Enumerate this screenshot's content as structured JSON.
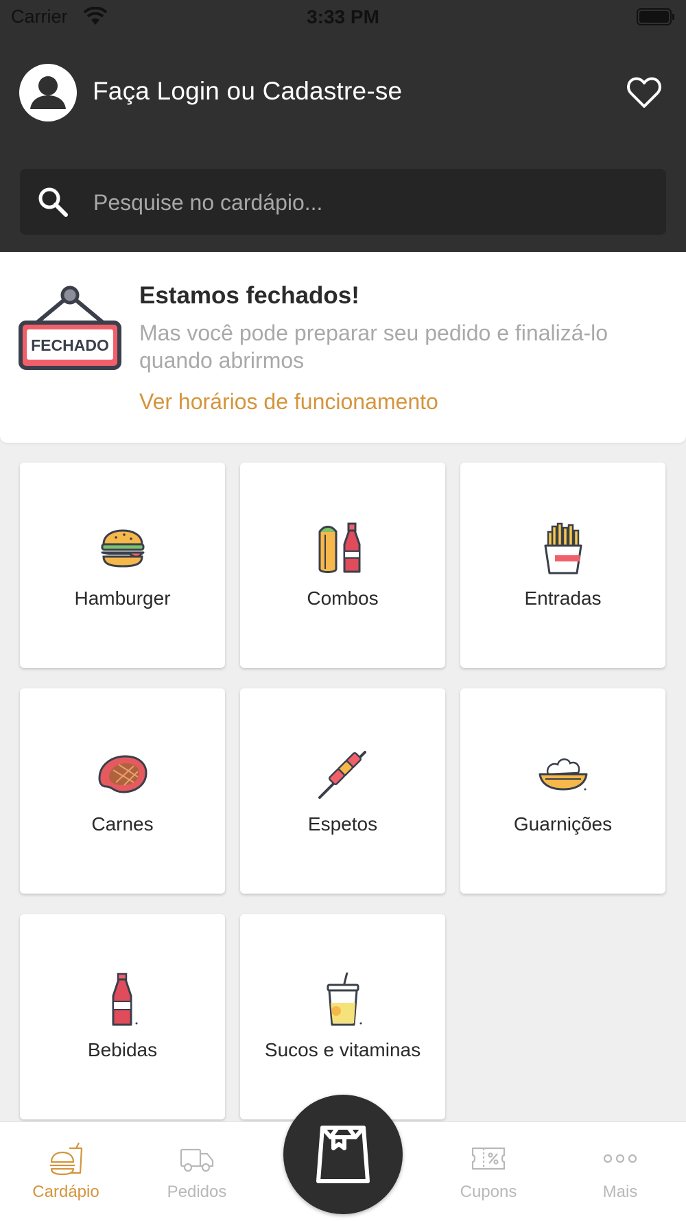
{
  "status_bar": {
    "carrier": "Carrier",
    "time": "3:33 PM"
  },
  "header": {
    "login_text": "Faça Login ou Cadastre-se",
    "avatar_icon": "user-avatar-icon",
    "favorite_icon": "heart-icon"
  },
  "search": {
    "placeholder": "Pesquise no cardápio...",
    "value": "",
    "icon": "search-icon"
  },
  "closed_notice": {
    "sign_text": "FECHADO",
    "title": "Estamos fechados!",
    "subtitle": "Mas você pode preparar seu pedido e finalizá-lo quando abrirmos",
    "link": "Ver horários de funcionamento"
  },
  "categories": [
    {
      "label": "Hamburger",
      "icon": "burger-icon"
    },
    {
      "label": "Combos",
      "icon": "combo-icon"
    },
    {
      "label": "Entradas",
      "icon": "fries-icon"
    },
    {
      "label": "Carnes",
      "icon": "steak-icon"
    },
    {
      "label": "Espetos",
      "icon": "skewer-icon"
    },
    {
      "label": "Guarnições",
      "icon": "side-dish-icon"
    },
    {
      "label": "Bebidas",
      "icon": "soda-bottle-icon"
    },
    {
      "label": "Sucos e vitaminas",
      "icon": "juice-cup-icon"
    }
  ],
  "bottom_nav": {
    "items": [
      {
        "label": "Cardápio",
        "icon": "menu-food-icon",
        "active": true
      },
      {
        "label": "Pedidos",
        "icon": "delivery-truck-icon",
        "active": false
      },
      {
        "label": "Cupons",
        "icon": "coupon-icon",
        "active": false
      },
      {
        "label": "Mais",
        "icon": "more-dots-icon",
        "active": false
      }
    ],
    "center_button_icon": "shopping-bag-icon"
  },
  "colors": {
    "header_bg": "#303030",
    "accent": "#d4943c",
    "sign_red": "#f1606a"
  }
}
